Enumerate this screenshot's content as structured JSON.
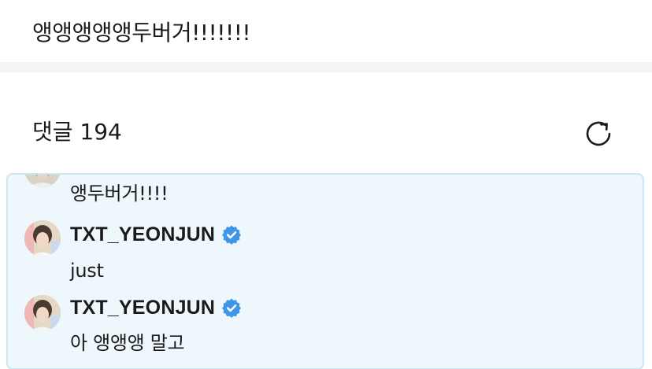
{
  "post": {
    "text": "앵앵앵앵앵두버거!!!!!!!"
  },
  "comments": {
    "header": "댓글 194",
    "refresh_icon": "refresh-icon",
    "thread": [
      {
        "text": "앵두버거!!!!"
      },
      {
        "username": "TXT_YEONJUN",
        "verified": true,
        "text": "just"
      },
      {
        "username": "TXT_YEONJUN",
        "verified": true,
        "text": "아 앵앵앵 말고"
      }
    ]
  },
  "colors": {
    "verified": "#3f96e8",
    "thread_background": "#eef7fc",
    "thread_border": "#cde6f4",
    "divider": "#f4f4f6"
  }
}
